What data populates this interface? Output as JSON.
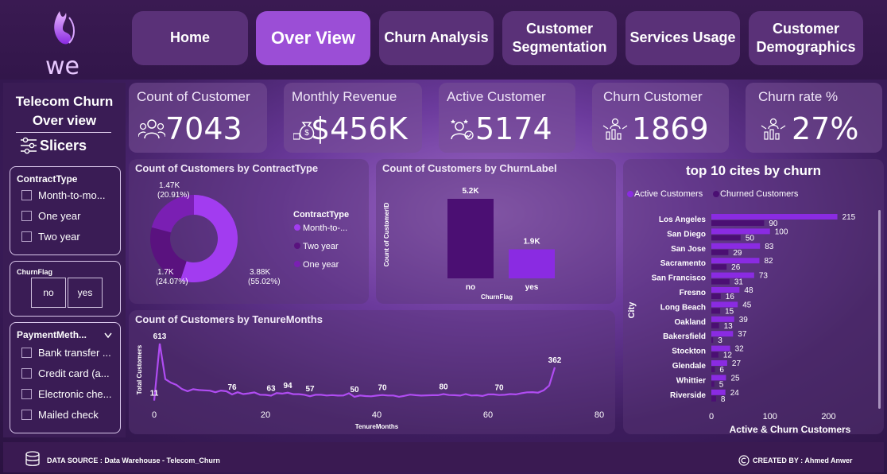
{
  "brand": {
    "logo_text": "we"
  },
  "nav": [
    {
      "label": "Home",
      "active": false
    },
    {
      "label": "Over View",
      "active": true
    },
    {
      "label": "Churn Analysis",
      "active": false
    },
    {
      "label": "Customer Segmentation",
      "active": false
    },
    {
      "label": "Services Usage",
      "active": false
    },
    {
      "label": "Customer Demographics",
      "active": false
    }
  ],
  "sidebar": {
    "title_line1": "Telecom Churn",
    "title_line2": "Over view",
    "slicers_label": "Slicers",
    "contract": {
      "header": "ContractType",
      "options": [
        "Month-to-mo...",
        "One year",
        "Two year"
      ]
    },
    "churnflag": {
      "header": "ChurnFlag",
      "options": [
        "no",
        "yes"
      ]
    },
    "payment": {
      "header": "PaymentMeth...",
      "options": [
        "Bank transfer ...",
        "Credit card (a...",
        "Electronic che...",
        "Mailed check"
      ]
    }
  },
  "kpis": [
    {
      "label": "Count of Customer",
      "value": "7043",
      "icon": "users-icon"
    },
    {
      "label": "Monthly Revenue",
      "value": "$456K",
      "icon": "money-bag-icon"
    },
    {
      "label": "Active Customer",
      "value": "5174",
      "icon": "active-customer-icon"
    },
    {
      "label": "Churn Customer",
      "value": "1869",
      "icon": "churn-customer-icon"
    },
    {
      "label": "Churn rate %",
      "value": "27%",
      "icon": "churn-rate-icon"
    }
  ],
  "colors": {
    "accent": "#9b4ed6",
    "bar_active": "#8a2be2",
    "bar_churn": "#4b0f73",
    "donut_month": "#a23cf0",
    "donut_two": "#5a127f",
    "donut_one": "#7a1fb3"
  },
  "chart_data": [
    {
      "type": "pie",
      "title": "Count of Customers by ContractType",
      "legend_title": "ContractType",
      "legend": [
        "Month-to-...",
        "Two year",
        "One year"
      ],
      "categories": [
        "Month-to-month",
        "Two year",
        "One year"
      ],
      "values": [
        3880,
        1700,
        1470
      ],
      "labels": [
        {
          "value": "3.88K",
          "pct": "(55.02%)"
        },
        {
          "value": "1.7K",
          "pct": "(24.07%)"
        },
        {
          "value": "1.47K",
          "pct": "(20.91%)"
        }
      ]
    },
    {
      "type": "bar",
      "title": "Count of Customers by ChurnLabel",
      "xlabel": "ChurnFlag",
      "ylabel": "Count of CustomerID",
      "categories": [
        "no",
        "yes"
      ],
      "values": [
        5200,
        1900
      ],
      "value_labels": [
        "5.2K",
        "1.9K"
      ]
    },
    {
      "type": "line",
      "title": "Count of Customers by TenureMonths",
      "xlabel": "TenureMonths",
      "ylabel": "Total Customers",
      "x_ticks": [
        "0",
        "20",
        "40",
        "60",
        "80"
      ],
      "xlim": [
        0,
        80
      ],
      "points": [
        {
          "x": 0,
          "y": 11
        },
        {
          "x": 1,
          "y": 613
        },
        {
          "x": 2,
          "y": 238
        },
        {
          "x": 3,
          "y": 200
        },
        {
          "x": 4,
          "y": 176
        },
        {
          "x": 5,
          "y": 133
        },
        {
          "x": 6,
          "y": 110
        },
        {
          "x": 7,
          "y": 131
        },
        {
          "x": 8,
          "y": 123
        },
        {
          "x": 9,
          "y": 119
        },
        {
          "x": 10,
          "y": 116
        },
        {
          "x": 11,
          "y": 99
        },
        {
          "x": 12,
          "y": 117
        },
        {
          "x": 13,
          "y": 109
        },
        {
          "x": 14,
          "y": 76
        },
        {
          "x": 15,
          "y": 99
        },
        {
          "x": 16,
          "y": 80
        },
        {
          "x": 17,
          "y": 87
        },
        {
          "x": 18,
          "y": 97
        },
        {
          "x": 19,
          "y": 73
        },
        {
          "x": 20,
          "y": 71
        },
        {
          "x": 21,
          "y": 63
        },
        {
          "x": 22,
          "y": 90
        },
        {
          "x": 23,
          "y": 85
        },
        {
          "x": 24,
          "y": 94
        },
        {
          "x": 25,
          "y": 79
        },
        {
          "x": 26,
          "y": 79
        },
        {
          "x": 27,
          "y": 72
        },
        {
          "x": 28,
          "y": 57
        },
        {
          "x": 29,
          "y": 72
        },
        {
          "x": 30,
          "y": 72
        },
        {
          "x": 31,
          "y": 65
        },
        {
          "x": 32,
          "y": 69
        },
        {
          "x": 33,
          "y": 64
        },
        {
          "x": 34,
          "y": 65
        },
        {
          "x": 35,
          "y": 88
        },
        {
          "x": 36,
          "y": 50
        },
        {
          "x": 37,
          "y": 65
        },
        {
          "x": 38,
          "y": 59
        },
        {
          "x": 39,
          "y": 56
        },
        {
          "x": 40,
          "y": 64
        },
        {
          "x": 41,
          "y": 70
        },
        {
          "x": 42,
          "y": 65
        },
        {
          "x": 43,
          "y": 65
        },
        {
          "x": 44,
          "y": 51
        },
        {
          "x": 45,
          "y": 61
        },
        {
          "x": 46,
          "y": 74
        },
        {
          "x": 47,
          "y": 68
        },
        {
          "x": 48,
          "y": 64
        },
        {
          "x": 49,
          "y": 66
        },
        {
          "x": 50,
          "y": 68
        },
        {
          "x": 51,
          "y": 68
        },
        {
          "x": 52,
          "y": 80
        },
        {
          "x": 53,
          "y": 70
        },
        {
          "x": 54,
          "y": 68
        },
        {
          "x": 55,
          "y": 64
        },
        {
          "x": 56,
          "y": 80
        },
        {
          "x": 57,
          "y": 65
        },
        {
          "x": 58,
          "y": 67
        },
        {
          "x": 59,
          "y": 60
        },
        {
          "x": 60,
          "y": 76
        },
        {
          "x": 61,
          "y": 76
        },
        {
          "x": 62,
          "y": 70
        },
        {
          "x": 63,
          "y": 72
        },
        {
          "x": 64,
          "y": 80
        },
        {
          "x": 65,
          "y": 76
        },
        {
          "x": 66,
          "y": 89
        },
        {
          "x": 67,
          "y": 98
        },
        {
          "x": 68,
          "y": 100
        },
        {
          "x": 69,
          "y": 95
        },
        {
          "x": 70,
          "y": 119
        },
        {
          "x": 71,
          "y": 170
        },
        {
          "x": 72,
          "y": 362
        }
      ],
      "annotations": [
        {
          "x": 0,
          "label": "11"
        },
        {
          "x": 1,
          "label": "613"
        },
        {
          "x": 14,
          "label": "76"
        },
        {
          "x": 21,
          "label": "63"
        },
        {
          "x": 24,
          "label": "94"
        },
        {
          "x": 28,
          "label": "57"
        },
        {
          "x": 36,
          "label": "50"
        },
        {
          "x": 41,
          "label": "70"
        },
        {
          "x": 52,
          "label": "80"
        },
        {
          "x": 62,
          "label": "70"
        },
        {
          "x": 72,
          "label": "362"
        }
      ]
    },
    {
      "type": "bar",
      "orientation": "horizontal",
      "title": "top 10 cites by churn",
      "xlabel": "Active & Churn Customers",
      "ylabel": "City",
      "x_ticks": [
        "0",
        "100",
        "200"
      ],
      "xlim": [
        0,
        240
      ],
      "legend": [
        "Active Customers",
        "Churned Customers"
      ],
      "categories": [
        "Los Angeles",
        "San Diego",
        "San Jose",
        "Sacramento",
        "San Francisco",
        "Fresno",
        "Long Beach",
        "Oakland",
        "Bakersfield",
        "Stockton",
        "Glendale",
        "Whittier",
        "Riverside"
      ],
      "series": [
        {
          "name": "Active Customers",
          "values": [
            215,
            100,
            83,
            82,
            73,
            48,
            45,
            39,
            37,
            32,
            27,
            25,
            24
          ]
        },
        {
          "name": "Churned Customers",
          "values": [
            90,
            50,
            29,
            26,
            31,
            16,
            15,
            13,
            3,
            12,
            6,
            5,
            8
          ]
        }
      ]
    }
  ],
  "footer": {
    "source": "DATA SOURCE : Data Warehouse - Telecom_Churn",
    "credit": "CREATED BY :  Ahmed Anwer"
  }
}
